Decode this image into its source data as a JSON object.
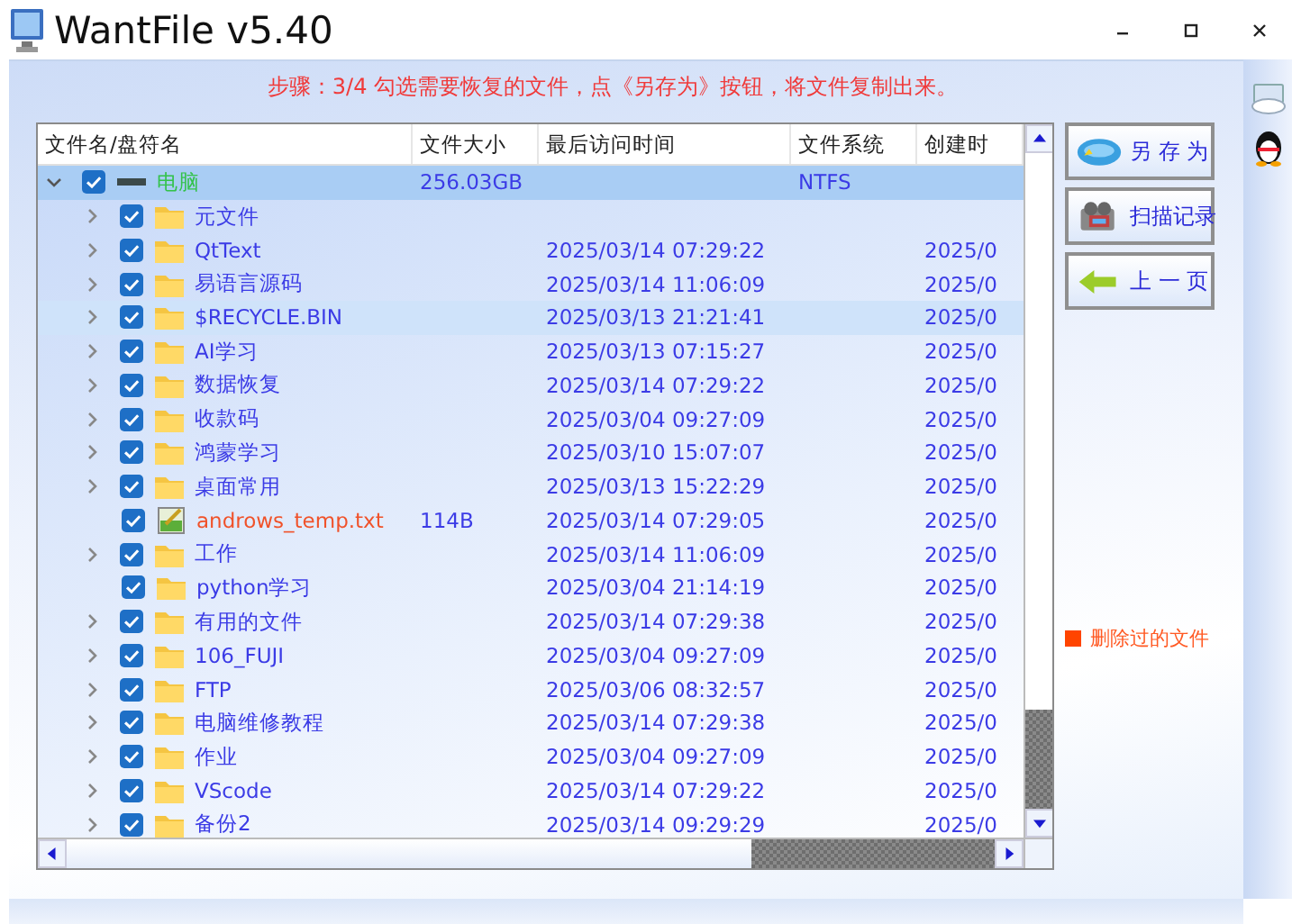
{
  "window": {
    "title": "WantFile v5.40"
  },
  "step_text": "步骤：3/4 勾选需要恢复的文件，点《另存为》按钮，将文件复制出来。",
  "table": {
    "columns": [
      "文件名/盘符名",
      "文件大小",
      "最后访问时间",
      "文件系统",
      "创建时"
    ],
    "tree": [
      {
        "kind": "drive",
        "name": "电脑",
        "size": "256.03GB",
        "fs": "NTFS",
        "checked": true,
        "expanded": true,
        "deleted": false,
        "selected": true,
        "hovered": false,
        "children": [
          {
            "kind": "folder",
            "name": "元文件",
            "checked": true,
            "expanded": false,
            "deleted": false,
            "selected": false,
            "hovered": false
          },
          {
            "kind": "folder",
            "name": "QtText",
            "accessed": "2025/03/14 07:29:22",
            "created": "2025/0",
            "checked": true,
            "expanded": false,
            "deleted": false,
            "selected": false,
            "hovered": false
          },
          {
            "kind": "folder",
            "name": "易语言源码",
            "accessed": "2025/03/14 11:06:09",
            "created": "2025/0",
            "checked": true,
            "expanded": false,
            "deleted": false,
            "selected": false,
            "hovered": false
          },
          {
            "kind": "folder",
            "name": "$RECYCLE.BIN",
            "accessed": "2025/03/13 21:21:41",
            "created": "2025/0",
            "checked": true,
            "expanded": false,
            "deleted": false,
            "selected": false,
            "hovered": true
          },
          {
            "kind": "folder",
            "name": "AI学习",
            "accessed": "2025/03/13 07:15:27",
            "created": "2025/0",
            "checked": true,
            "expanded": false,
            "deleted": false,
            "selected": false,
            "hovered": false
          },
          {
            "kind": "folder",
            "name": "数据恢复",
            "accessed": "2025/03/14 07:29:22",
            "created": "2025/0",
            "checked": true,
            "expanded": false,
            "deleted": false,
            "selected": false,
            "hovered": false
          },
          {
            "kind": "folder",
            "name": "收款码",
            "accessed": "2025/03/04 09:27:09",
            "created": "2025/0",
            "checked": true,
            "expanded": false,
            "deleted": false,
            "selected": false,
            "hovered": false
          },
          {
            "kind": "folder",
            "name": "鸿蒙学习",
            "accessed": "2025/03/10 15:07:07",
            "created": "2025/0",
            "checked": true,
            "expanded": false,
            "deleted": false,
            "selected": false,
            "hovered": false
          },
          {
            "kind": "folder",
            "name": "桌面常用",
            "accessed": "2025/03/13 15:22:29",
            "created": "2025/0",
            "checked": true,
            "expanded": false,
            "deleted": false,
            "selected": false,
            "hovered": false
          },
          {
            "kind": "file",
            "name": "androws_temp.txt",
            "size": "114B",
            "accessed": "2025/03/14 07:29:05",
            "created": "2025/0",
            "checked": true,
            "deleted": true,
            "selected": false,
            "hovered": false
          },
          {
            "kind": "folder",
            "name": "工作",
            "accessed": "2025/03/14 11:06:09",
            "created": "2025/0",
            "checked": true,
            "expanded": false,
            "deleted": false,
            "selected": false,
            "hovered": false
          },
          {
            "kind": "leaf-folder",
            "name": "python学习",
            "accessed": "2025/03/04 21:14:19",
            "created": "2025/0",
            "checked": true,
            "deleted": false,
            "selected": false,
            "hovered": false
          },
          {
            "kind": "folder",
            "name": "有用的文件",
            "accessed": "2025/03/14 07:29:38",
            "created": "2025/0",
            "checked": true,
            "expanded": false,
            "deleted": false,
            "selected": false,
            "hovered": false
          },
          {
            "kind": "folder",
            "name": "106_FUJI",
            "accessed": "2025/03/04 09:27:09",
            "created": "2025/0",
            "checked": true,
            "expanded": false,
            "deleted": false,
            "selected": false,
            "hovered": false
          },
          {
            "kind": "folder",
            "name": "FTP",
            "accessed": "2025/03/06 08:32:57",
            "created": "2025/0",
            "checked": true,
            "expanded": false,
            "deleted": false,
            "selected": false,
            "hovered": false
          },
          {
            "kind": "folder",
            "name": "电脑维修教程",
            "accessed": "2025/03/14 07:29:38",
            "created": "2025/0",
            "checked": true,
            "expanded": false,
            "deleted": false,
            "selected": false,
            "hovered": false
          },
          {
            "kind": "folder",
            "name": "作业",
            "accessed": "2025/03/04 09:27:09",
            "created": "2025/0",
            "checked": true,
            "expanded": false,
            "deleted": false,
            "selected": false,
            "hovered": false
          },
          {
            "kind": "folder",
            "name": "VScode",
            "accessed": "2025/03/14 07:29:22",
            "created": "2025/0",
            "checked": true,
            "expanded": false,
            "deleted": false,
            "selected": false,
            "hovered": false
          },
          {
            "kind": "folder",
            "name": "备份2",
            "accessed": "2025/03/14 09:29:29",
            "created": "2025/0",
            "checked": true,
            "expanded": false,
            "deleted": false,
            "selected": false,
            "hovered": false
          }
        ]
      }
    ]
  },
  "buttons": [
    {
      "kind": "save",
      "label": "另 存 为"
    },
    {
      "kind": "scan",
      "label": "扫描记录"
    },
    {
      "kind": "back",
      "label": "上 一 页"
    }
  ],
  "legend": {
    "label": "删除过的文件",
    "color": "#ff4400"
  }
}
